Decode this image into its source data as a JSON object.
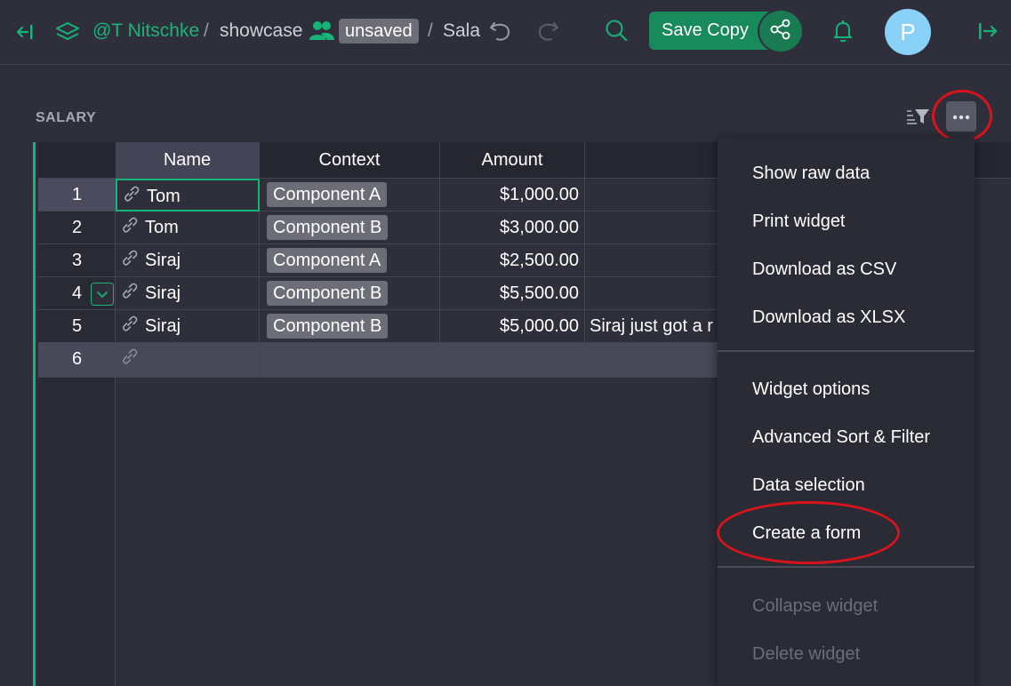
{
  "header": {
    "org": "@T Nitschke",
    "separator": "/",
    "doc": "showcase",
    "status_badge": "unsaved",
    "page": "Sala",
    "save_copy_label": "Save Copy",
    "avatar_letter": "P",
    "accent_color": "#16b378"
  },
  "widget": {
    "title": "SALARY"
  },
  "table": {
    "columns": [
      "Name",
      "Context",
      "Amount"
    ],
    "rows": [
      {
        "num": "1",
        "name": "Tom",
        "context": "Component A",
        "amount": "$1,000.00",
        "notes": ""
      },
      {
        "num": "2",
        "name": "Tom",
        "context": "Component B",
        "amount": "$3,000.00",
        "notes": ""
      },
      {
        "num": "3",
        "name": "Siraj",
        "context": "Component A",
        "amount": "$2,500.00",
        "notes": ""
      },
      {
        "num": "4",
        "name": "Siraj",
        "context": "Component B",
        "amount": "$5,500.00",
        "notes": ""
      },
      {
        "num": "5",
        "name": "Siraj",
        "context": "Component B",
        "amount": "$5,000.00",
        "notes": "Siraj just got a r"
      }
    ],
    "new_row_num": "6"
  },
  "menu": {
    "items_group1": [
      "Show raw data",
      "Print widget",
      "Download as CSV",
      "Download as XLSX"
    ],
    "items_group2": [
      "Widget options",
      "Advanced Sort & Filter",
      "Data selection",
      "Create a form"
    ],
    "items_group3_disabled": [
      "Collapse widget",
      "Delete widget"
    ]
  }
}
